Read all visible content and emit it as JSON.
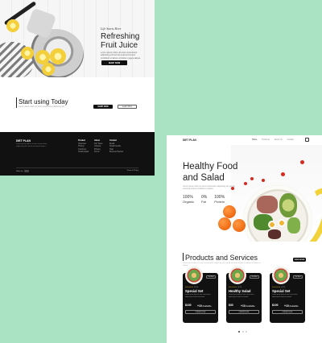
{
  "left_page": {
    "hero": {
      "subtitle": "Life Starts Here",
      "title_line1": "Refreshing",
      "title_line2": "Fruit Juice",
      "description": "Lorem ipsum dolor sit amet consectetur adipiscing elit sed do eiusmod tempor incididunt ut labore et dolore magna aliqua.",
      "shop_button": "SHOP NOW"
    },
    "cta": {
      "heading": "Start using Today",
      "subtext": "Lorem ipsum dolor sit amet consectetur adipiscing elit.",
      "primary_button": "SHOP NOW",
      "secondary_button": "Learn More"
    },
    "footer": {
      "brand": "DIET PLAN",
      "tagline": "Lorem ipsum dolor sit amet consectetur adipiscing elit sed do eiusmod tempor.",
      "columns": [
        {
          "heading": "Product",
          "items": [
            "Overview",
            "Pricing",
            "Customer",
            "Testimonials"
          ]
        },
        {
          "heading": "About",
          "items": [
            "Our Team",
            "Careers",
            "Privacy",
            "Terms"
          ]
        },
        {
          "heading": "Contact",
          "items": [
            "Email",
            "Social media",
            "Help",
            "Become Partner"
          ]
        }
      ],
      "copyright": "Made by",
      "terms": "Terms & Policy"
    }
  },
  "right_page": {
    "nav": {
      "logo": "DIET PLAN",
      "links": [
        "Home",
        "Products",
        "About Us",
        "Contact"
      ]
    },
    "hero": {
      "title_line1": "Healthy Food",
      "title_line2": "and Salad",
      "description": "Lorem ipsum dolor sit amet consectetur adipiscing elit sed do eiusmod tempor incididunt ut labore.",
      "stats": [
        {
          "value": "100%",
          "label": "Organic"
        },
        {
          "value": "0%",
          "label": "Fat"
        },
        {
          "value": "100%",
          "label": "Protein"
        }
      ]
    },
    "products": {
      "heading": "Products and Services",
      "subtext": "Lorem ipsum dolor sit amet consectetur adipiscing elit sed do eiusmod tempor incididunt ut labore et dolore.",
      "view_all": "VIEW MORE",
      "cards": [
        {
          "badge": "Get Now",
          "stars": "★★★★★",
          "reviews": "(4.5)",
          "name": "Special Set",
          "desc": "Lorem ipsum dolor sit amet consectetur adipiscing elit sed do eiusmod.",
          "price": "$100",
          "available_count": "+10",
          "available_label": "Available",
          "order": "ORDER NOW"
        },
        {
          "badge": "Get Now",
          "stars": "★★★★★",
          "reviews": "(4.5)",
          "name": "Healthy Salad",
          "desc": "Lorem ipsum dolor sit amet consectetur adipiscing elit sed do eiusmod.",
          "price": "$30",
          "available_count": "+10",
          "available_label": "Available",
          "order": "ORDER NOW"
        },
        {
          "badge": "Get Now",
          "stars": "★★★★★",
          "reviews": "(4.5)",
          "name": "Special Set",
          "desc": "Lorem ipsum dolor sit amet consectetur adipiscing elit sed do eiusmod.",
          "price": "$100",
          "available_count": "+10",
          "available_label": "Available",
          "order": "ORDER NOW"
        }
      ]
    }
  },
  "colors": {
    "background": "#a9e3c4",
    "dark": "#111111",
    "star": "#f5c93a",
    "tomato": "#d72a1f",
    "orange": "#ef6a12"
  }
}
